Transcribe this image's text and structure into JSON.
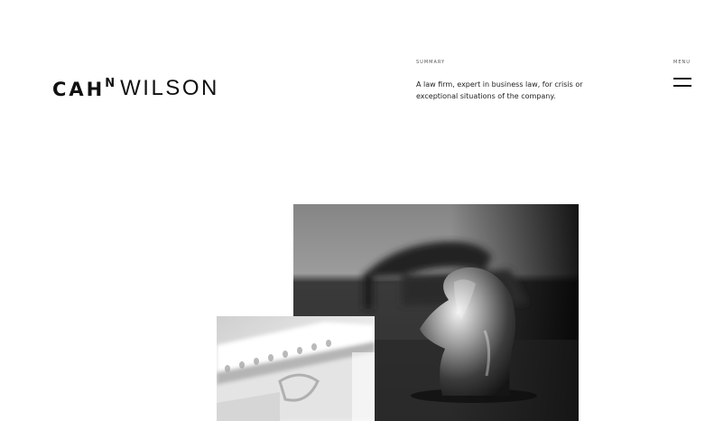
{
  "brand": {
    "logo_part_1": "CAH",
    "logo_part_2": "N",
    "logo_part_3": "WILSON"
  },
  "summary": {
    "label": "SUMMARY",
    "text_line_1": "A law firm, expert in business law, for crisis or",
    "text_line_2": "exceptional situations of the company."
  },
  "menu": {
    "label": "MENU",
    "icon": "hamburger-menu-icon"
  },
  "colors": {
    "background": "#ffffff",
    "text": "#111111"
  }
}
